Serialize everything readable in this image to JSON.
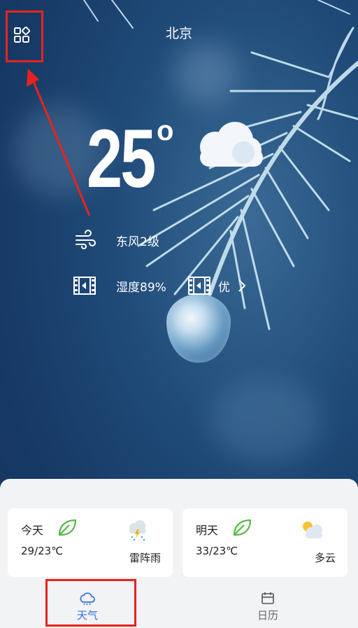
{
  "header": {
    "city": "北京",
    "menu_icon": "grid-icon"
  },
  "current": {
    "temperature": "25",
    "degree_symbol": "o",
    "condition_icon": "cloud-icon",
    "wind": "东风2级",
    "humidity": "湿度89%",
    "air_quality": "优",
    "wind_icon": "wind-icon",
    "humidity_icon": "film-icon",
    "air_icon": "film-icon"
  },
  "forecast": [
    {
      "day": "今天",
      "range": "29/23℃",
      "desc": "雷阵雨",
      "icon": "thunder-rain-icon",
      "leaf_color": "#59b84a"
    },
    {
      "day": "明天",
      "range": "33/23℃",
      "desc": "多云",
      "icon": "partly-cloudy-icon",
      "leaf_color": "#59b84a"
    }
  ],
  "nav": [
    {
      "label": "天气",
      "icon": "cloud-outline-icon",
      "active": true
    },
    {
      "label": "日历",
      "icon": "calendar-icon",
      "active": false
    }
  ],
  "colors": {
    "accent": "#3a6fe0",
    "annotation": "#e8231f",
    "panel_bg": "#f2f3f5"
  }
}
